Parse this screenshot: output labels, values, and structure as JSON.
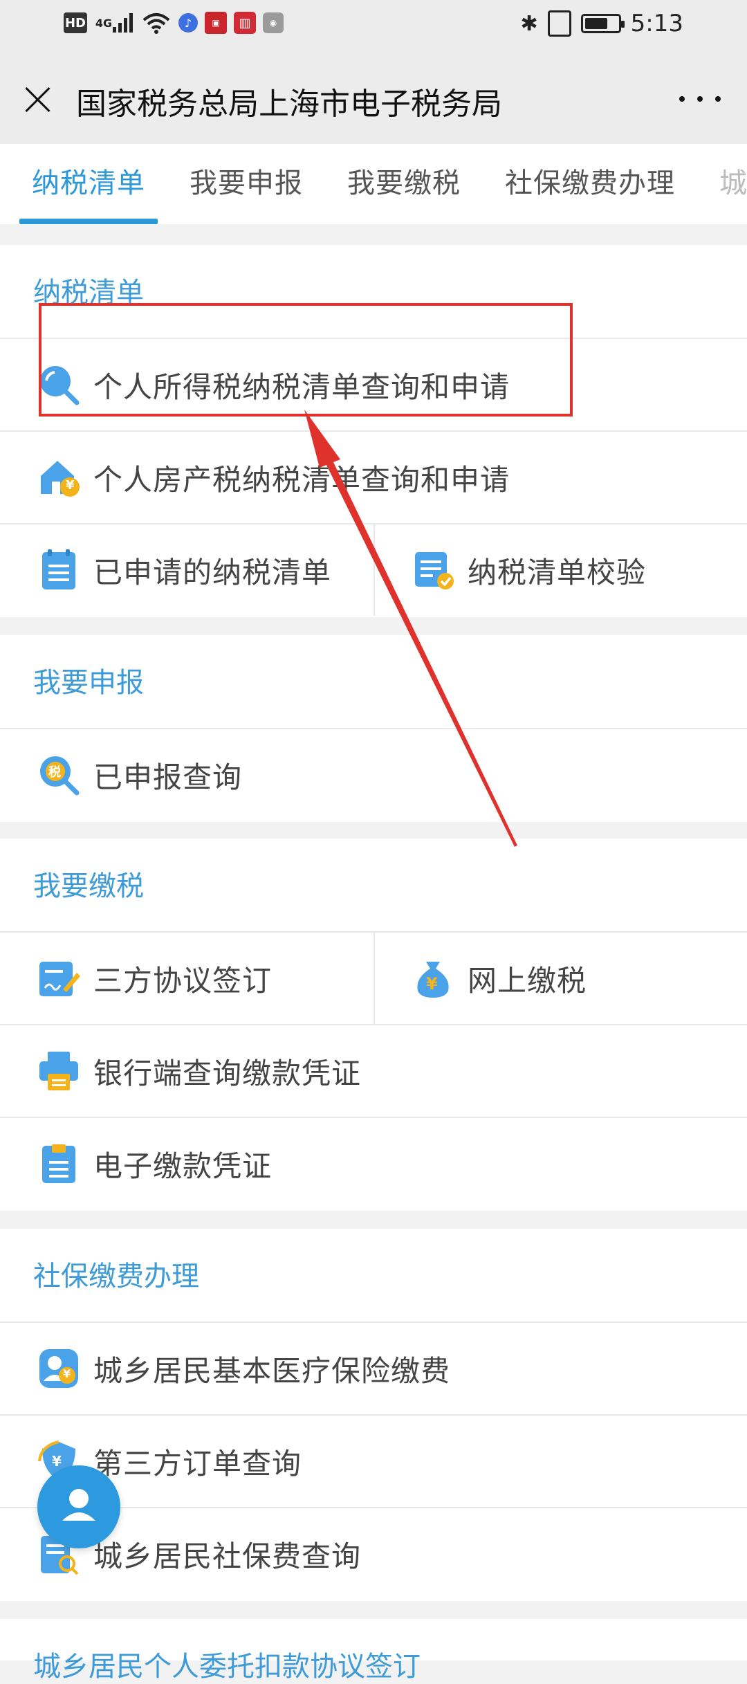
{
  "status_bar": {
    "hd": "HD",
    "signal": "4G",
    "time": "5:13",
    "battery_level": 0.7
  },
  "navbar": {
    "title": "国家税务总局上海市电子税务局"
  },
  "tabs": [
    {
      "label": "纳税清单",
      "active": true
    },
    {
      "label": "我要申报",
      "active": false
    },
    {
      "label": "我要缴税",
      "active": false
    },
    {
      "label": "社保缴费办理",
      "active": false
    },
    {
      "label": "城",
      "active": false
    }
  ],
  "sections": {
    "tax_list": {
      "title": "纳税清单",
      "items": {
        "income_tax": "个人所得税纳税清单查询和申请",
        "property_tax": "个人房产税纳税清单查询和申请",
        "applied": "已申请的纳税清单",
        "verify": "纳税清单校验"
      }
    },
    "declare": {
      "title": "我要申报",
      "items": {
        "declared_query": "已申报查询"
      }
    },
    "pay": {
      "title": "我要缴税",
      "items": {
        "tripartite": "三方协议签订",
        "online_pay": "网上缴税",
        "bank_voucher": "银行端查询缴款凭证",
        "e_voucher": "电子缴款凭证"
      }
    },
    "social": {
      "title": "社保缴费办理",
      "items": {
        "medical": "城乡居民基本医疗保险缴费",
        "third_party": "第三方订单查询",
        "social_query": "城乡居民社保费查询"
      }
    },
    "next_title": "城乡居民个人委托扣款协议签订"
  },
  "icon_glyphs": {
    "yuan": "¥",
    "tax": "税"
  },
  "colors": {
    "accent": "#2d98d8",
    "highlight": "#e0322d"
  }
}
